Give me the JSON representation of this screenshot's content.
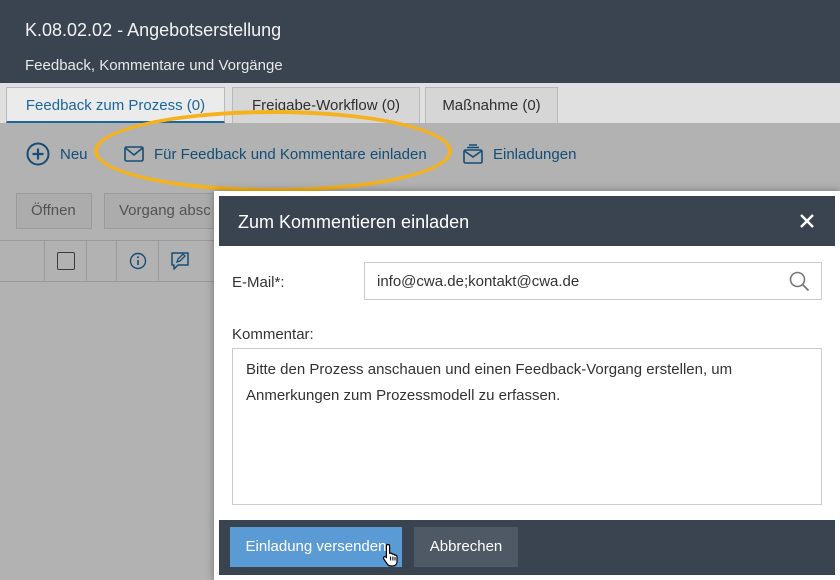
{
  "header": {
    "title": "K.08.02.02 - Angebotserstellung",
    "subtitle": "Feedback, Kommentare und Vorgänge"
  },
  "tabs": [
    {
      "label": "Feedback zum Prozess (0)",
      "active": true
    },
    {
      "label": "Freigabe-Workflow (0)",
      "active": false
    },
    {
      "label": "Maßnahme (0)",
      "active": false
    }
  ],
  "toolbar": {
    "new_label": "Neu",
    "invite_label": "Für Feedback und Kommentare einladen",
    "invitations_label": "Einladungen"
  },
  "actions": {
    "open_label": "Öffnen",
    "close_case_label": "Vorgang absc"
  },
  "modal": {
    "title": "Zum Kommentieren einladen",
    "email_label": "E-Mail*:",
    "email_value": "info@cwa.de;kontakt@cwa.de",
    "comment_label": "Kommentar:",
    "comment_value": "Bitte den Prozess anschauen und einen Feedback-Vorgang erstellen, um Anmerkungen zum Prozessmodell zu erfassen.",
    "send_label": "Einladung versenden",
    "cancel_label": "Abbrechen"
  },
  "icons": {
    "new": "plus-circle-icon",
    "invite": "envelope-icon",
    "invitations": "envelope-stack-icon",
    "close": "close-icon",
    "search": "search-icon",
    "info": "info-icon",
    "comment": "comment-edit-icon",
    "cursor": "hand-pointer-icon"
  },
  "colors": {
    "header_bg": "#3a4450",
    "accent": "#1f6fa8",
    "highlight": "#f5b21e",
    "primary_button": "#5b9bd5"
  }
}
